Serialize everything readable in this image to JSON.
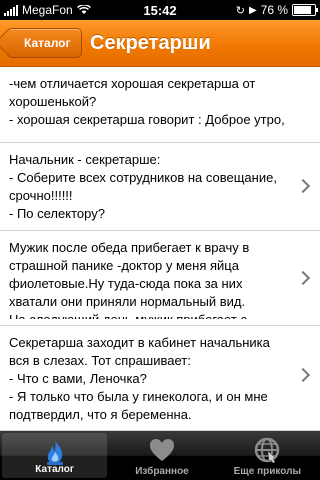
{
  "status_bar": {
    "carrier": "MegaFon",
    "time": "15:42",
    "battery": "76 %",
    "battery_level": 0.76
  },
  "nav": {
    "back_label": "Каталог",
    "title": "Секретарши"
  },
  "items": [
    {
      "text": "-чем отличается хорошая секретарша от хорошенькой?\n- хорошая секретарша говорит : Доброе утро,"
    },
    {
      "text": "Начальник - секретарше:\n- Соберите всех сотрудников на совещание, срочно!!!!!!\n- По селектору?\n- Нет, блин, через Одноклассников\", так"
    },
    {
      "text": "Мужик после обеда прибегает к врачу в страшной панике -доктор у меня яйца фиолетовые.Ну туда-сюда пока за них хватали они приняли нормальный вид.\nНа следующий день мужик прибегает с"
    },
    {
      "text": "Секретарша заходит в кабинет начальника вся в слезах. Тот спрашивает:\n- Что с вами, Леночка?\n- Я только что была у гинеколога, и он мне подтвердил, что я беременна."
    }
  ],
  "tabs": [
    {
      "label": "Каталог",
      "icon": "flame-icon",
      "active": true
    },
    {
      "label": "Избранное",
      "icon": "heart-icon",
      "active": false
    },
    {
      "label": "Еще приколы",
      "icon": "globe-icon",
      "active": false
    }
  ]
}
